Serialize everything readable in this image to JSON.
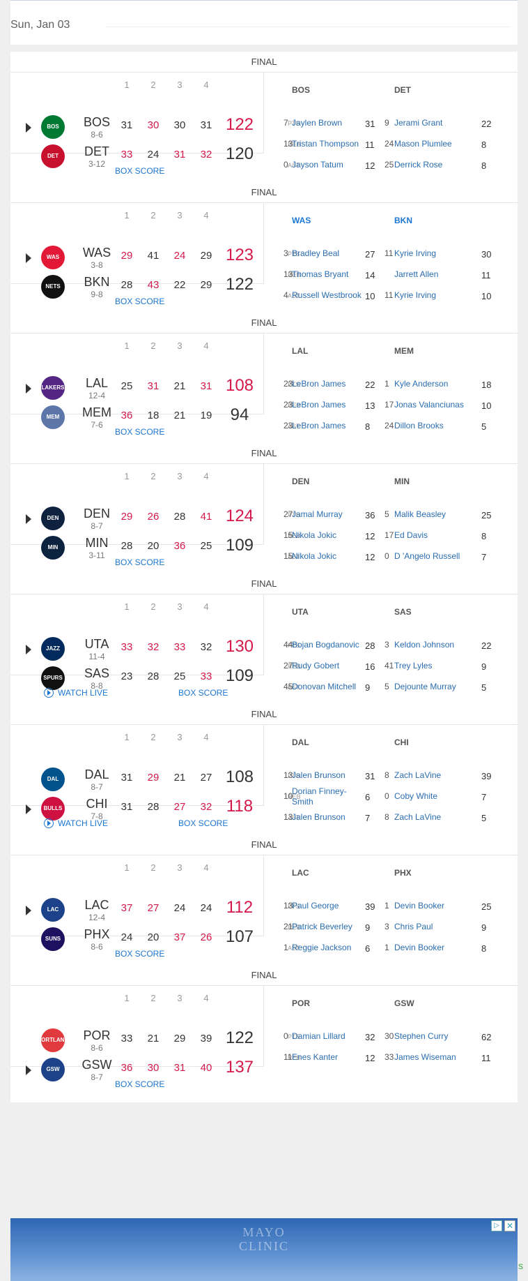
{
  "date": "Sun, Jan 03",
  "labels": {
    "final": "FINAL",
    "box_score": "BOX SCORE",
    "watch_live": "WATCH LIVE",
    "q": [
      "1",
      "2",
      "3",
      "4"
    ],
    "pts": "PTS",
    "reb": "REB",
    "ast": "AST"
  },
  "games": [
    {
      "watch_live": false,
      "teams": [
        {
          "abbr": "BOS",
          "record": "8-6",
          "logo": "celtics-logo",
          "color": "#007A33",
          "logo_text": "BOS",
          "q": [
            "31",
            "30",
            "30",
            "31"
          ],
          "hi": [
            false,
            true,
            false,
            false
          ],
          "total": "122",
          "winner": true,
          "arrow": true
        },
        {
          "abbr": "DET",
          "record": "3-12",
          "logo": "pistons-logo",
          "color": "#C8102E",
          "logo_text": "DET",
          "q": [
            "33",
            "24",
            "31",
            "32"
          ],
          "hi": [
            true,
            false,
            true,
            true
          ],
          "total": "120",
          "winner": false,
          "arrow": false
        }
      ],
      "leaders": {
        "teams": [
          "BOS",
          "DET"
        ],
        "blue": false,
        "rows": [
          {
            "a": {
              "num": "7",
              "name": "Jaylen Brown",
              "val": "31"
            },
            "b": {
              "num": "9",
              "name": "Jerami Grant",
              "val": "22"
            }
          },
          {
            "a": {
              "num": "13",
              "name": "Tristan Thompson",
              "val": "11"
            },
            "b": {
              "num": "24",
              "name": "Mason Plumlee",
              "val": "8"
            }
          },
          {
            "a": {
              "num": "0",
              "name": "Jayson Tatum",
              "val": "12"
            },
            "b": {
              "num": "25",
              "name": "Derrick Rose",
              "val": "8"
            }
          }
        ]
      }
    },
    {
      "watch_live": false,
      "teams": [
        {
          "abbr": "WAS",
          "record": "3-8",
          "logo": "wizards-logo",
          "color": "#E31837",
          "logo_text": "WAS",
          "q": [
            "29",
            "41",
            "24",
            "29"
          ],
          "hi": [
            true,
            false,
            true,
            false
          ],
          "total": "123",
          "winner": true,
          "arrow": true
        },
        {
          "abbr": "BKN",
          "record": "9-8",
          "logo": "nets-logo",
          "color": "#111111",
          "logo_text": "NETS",
          "q": [
            "28",
            "43",
            "22",
            "29"
          ],
          "hi": [
            false,
            true,
            false,
            false
          ],
          "total": "122",
          "winner": false,
          "arrow": false
        }
      ],
      "leaders": {
        "teams": [
          "WAS",
          "BKN"
        ],
        "blue": true,
        "rows": [
          {
            "a": {
              "num": "3",
              "name": "Bradley Beal",
              "val": "27"
            },
            "b": {
              "num": "11",
              "name": "Kyrie Irving",
              "val": "30"
            }
          },
          {
            "a": {
              "num": "13",
              "name": "Thomas Bryant",
              "val": "14"
            },
            "b": {
              "num": "",
              "name": "Jarrett Allen",
              "val": "11"
            }
          },
          {
            "a": {
              "num": "4",
              "name": "Russell Westbrook",
              "val": "10"
            },
            "b": {
              "num": "11",
              "name": "Kyrie Irving",
              "val": "10"
            }
          }
        ]
      }
    },
    {
      "watch_live": false,
      "teams": [
        {
          "abbr": "LAL",
          "record": "12-4",
          "logo": "lakers-logo",
          "color": "#552583",
          "logo_text": "LAKERS",
          "q": [
            "25",
            "31",
            "21",
            "31"
          ],
          "hi": [
            false,
            true,
            false,
            true
          ],
          "total": "108",
          "winner": true,
          "arrow": true
        },
        {
          "abbr": "MEM",
          "record": "7-6",
          "logo": "grizzlies-logo",
          "color": "#5D76A9",
          "logo_text": "MEM",
          "q": [
            "36",
            "18",
            "21",
            "19"
          ],
          "hi": [
            true,
            false,
            false,
            false
          ],
          "total": "94",
          "winner": false,
          "arrow": false
        }
      ],
      "leaders": {
        "teams": [
          "LAL",
          "MEM"
        ],
        "blue": false,
        "rows": [
          {
            "a": {
              "num": "23",
              "name": "LeBron James",
              "val": "22"
            },
            "b": {
              "num": "1",
              "name": "Kyle Anderson",
              "val": "18"
            }
          },
          {
            "a": {
              "num": "23",
              "name": "LeBron James",
              "val": "13"
            },
            "b": {
              "num": "17",
              "name": "Jonas Valanciunas",
              "val": "10"
            }
          },
          {
            "a": {
              "num": "23",
              "name": "LeBron James",
              "val": "8"
            },
            "b": {
              "num": "24",
              "name": "Dillon Brooks",
              "val": "5"
            }
          }
        ]
      }
    },
    {
      "watch_live": false,
      "teams": [
        {
          "abbr": "DEN",
          "record": "8-7",
          "logo": "nuggets-logo",
          "color": "#0E2240",
          "logo_text": "DEN",
          "q": [
            "29",
            "26",
            "28",
            "41"
          ],
          "hi": [
            true,
            true,
            false,
            true
          ],
          "total": "124",
          "winner": true,
          "arrow": true
        },
        {
          "abbr": "MIN",
          "record": "3-11",
          "logo": "timberwolves-logo",
          "color": "#0C2340",
          "logo_text": "MIN",
          "q": [
            "28",
            "20",
            "36",
            "25"
          ],
          "hi": [
            false,
            false,
            true,
            false
          ],
          "total": "109",
          "winner": false,
          "arrow": false
        }
      ],
      "leaders": {
        "teams": [
          "DEN",
          "MIN"
        ],
        "blue": false,
        "rows": [
          {
            "a": {
              "num": "27",
              "name": "Jamal Murray",
              "val": "36"
            },
            "b": {
              "num": "5",
              "name": "Malik Beasley",
              "val": "25"
            }
          },
          {
            "a": {
              "num": "15",
              "name": "Nikola Jokic",
              "val": "12"
            },
            "b": {
              "num": "17",
              "name": "Ed Davis",
              "val": "8"
            }
          },
          {
            "a": {
              "num": "15",
              "name": "Nikola Jokic",
              "val": "12"
            },
            "b": {
              "num": "0",
              "name": "D 'Angelo Russell",
              "val": "7"
            }
          }
        ]
      }
    },
    {
      "watch_live": true,
      "teams": [
        {
          "abbr": "UTA",
          "record": "11-4",
          "logo": "jazz-logo",
          "color": "#002B5C",
          "logo_text": "JAZZ",
          "q": [
            "33",
            "32",
            "33",
            "32"
          ],
          "hi": [
            true,
            true,
            true,
            false
          ],
          "total": "130",
          "winner": true,
          "arrow": true
        },
        {
          "abbr": "SAS",
          "record": "8-8",
          "logo": "spurs-logo",
          "color": "#111111",
          "logo_text": "SPURS",
          "q": [
            "23",
            "28",
            "25",
            "33"
          ],
          "hi": [
            false,
            false,
            false,
            true
          ],
          "total": "109",
          "winner": false,
          "arrow": false
        }
      ],
      "leaders": {
        "teams": [
          "UTA",
          "SAS"
        ],
        "blue": false,
        "rows": [
          {
            "a": {
              "num": "44",
              "name": "Bojan Bogdanovic",
              "val": "28"
            },
            "b": {
              "num": "3",
              "name": "Keldon Johnson",
              "val": "22"
            }
          },
          {
            "a": {
              "num": "27",
              "name": "Rudy Gobert",
              "val": "16"
            },
            "b": {
              "num": "41",
              "name": "Trey Lyles",
              "val": "9"
            }
          },
          {
            "a": {
              "num": "45",
              "name": "Donovan Mitchell",
              "val": "9"
            },
            "b": {
              "num": "5",
              "name": "Dejounte Murray",
              "val": "5"
            }
          }
        ]
      }
    },
    {
      "watch_live": true,
      "teams": [
        {
          "abbr": "DAL",
          "record": "8-7",
          "logo": "mavericks-logo",
          "color": "#00538C",
          "logo_text": "DAL",
          "q": [
            "31",
            "29",
            "21",
            "27"
          ],
          "hi": [
            false,
            true,
            false,
            false
          ],
          "total": "108",
          "winner": false,
          "arrow": false
        },
        {
          "abbr": "CHI",
          "record": "7-8",
          "logo": "bulls-logo",
          "color": "#CE1141",
          "logo_text": "BULLS",
          "q": [
            "31",
            "28",
            "27",
            "32"
          ],
          "hi": [
            false,
            false,
            true,
            true
          ],
          "total": "118",
          "winner": true,
          "arrow": true
        }
      ],
      "leaders": {
        "teams": [
          "DAL",
          "CHI"
        ],
        "blue": false,
        "rows": [
          {
            "a": {
              "num": "13",
              "name": "Jalen Brunson",
              "val": "31"
            },
            "b": {
              "num": "8",
              "name": "Zach LaVine",
              "val": "39"
            }
          },
          {
            "a": {
              "num": "10",
              "name": "Dorian Finney-Smith",
              "val": "6"
            },
            "b": {
              "num": "0",
              "name": "Coby White",
              "val": "7"
            }
          },
          {
            "a": {
              "num": "13",
              "name": "Jalen Brunson",
              "val": "7"
            },
            "b": {
              "num": "8",
              "name": "Zach LaVine",
              "val": "5"
            }
          }
        ]
      }
    },
    {
      "watch_live": false,
      "teams": [
        {
          "abbr": "LAC",
          "record": "12-4",
          "logo": "clippers-logo",
          "color": "#1D428A",
          "logo_text": "LAC",
          "q": [
            "37",
            "27",
            "24",
            "24"
          ],
          "hi": [
            true,
            true,
            false,
            false
          ],
          "total": "112",
          "winner": true,
          "arrow": true
        },
        {
          "abbr": "PHX",
          "record": "8-6",
          "logo": "suns-logo",
          "color": "#1D1160",
          "logo_text": "SUNS",
          "q": [
            "24",
            "20",
            "37",
            "26"
          ],
          "hi": [
            false,
            false,
            true,
            true
          ],
          "total": "107",
          "winner": false,
          "arrow": false
        }
      ],
      "leaders": {
        "teams": [
          "LAC",
          "PHX"
        ],
        "blue": false,
        "rows": [
          {
            "a": {
              "num": "13",
              "name": "Paul George",
              "val": "39"
            },
            "b": {
              "num": "1",
              "name": "Devin Booker",
              "val": "25"
            }
          },
          {
            "a": {
              "num": "21",
              "name": "Patrick Beverley",
              "val": "9"
            },
            "b": {
              "num": "3",
              "name": "Chris Paul",
              "val": "9"
            }
          },
          {
            "a": {
              "num": "1",
              "name": "Reggie Jackson",
              "val": "6"
            },
            "b": {
              "num": "1",
              "name": "Devin Booker",
              "val": "8"
            }
          }
        ]
      }
    },
    {
      "watch_live": false,
      "teams": [
        {
          "abbr": "POR",
          "record": "8-6",
          "logo": "blazers-logo",
          "color": "#E03A3E",
          "logo_text": "PORTLAND",
          "q": [
            "33",
            "21",
            "29",
            "39"
          ],
          "hi": [
            false,
            false,
            false,
            false
          ],
          "total": "122",
          "winner": false,
          "arrow": false
        },
        {
          "abbr": "GSW",
          "record": "8-7",
          "logo": "warriors-logo",
          "color": "#1D428A",
          "logo_text": "GSW",
          "q": [
            "36",
            "30",
            "31",
            "40"
          ],
          "hi": [
            true,
            true,
            true,
            true
          ],
          "total": "137",
          "winner": true,
          "arrow": true
        }
      ],
      "leaders": {
        "teams": [
          "POR",
          "GSW"
        ],
        "blue": false,
        "rows": [
          {
            "a": {
              "num": "0",
              "name": "Damian Lillard",
              "val": "32"
            },
            "b": {
              "num": "30",
              "name": "Stephen Curry",
              "val": "62"
            }
          },
          {
            "a": {
              "num": "11",
              "name": "Enes Kanter",
              "val": "12"
            },
            "b": {
              "num": "33",
              "name": "James Wiseman",
              "val": "11"
            }
          },
          {
            "a": {
              "num": "",
              "name": "",
              "val": ""
            },
            "b": {
              "num": "",
              "name": "",
              "val": ""
            }
          }
        ]
      }
    }
  ],
  "ad": {
    "brand_line1": "MAYO",
    "brand_line2": "CLINIC",
    "info_icon": "adchoices-icon",
    "close_icon": "close-icon",
    "edge_text": "s"
  }
}
